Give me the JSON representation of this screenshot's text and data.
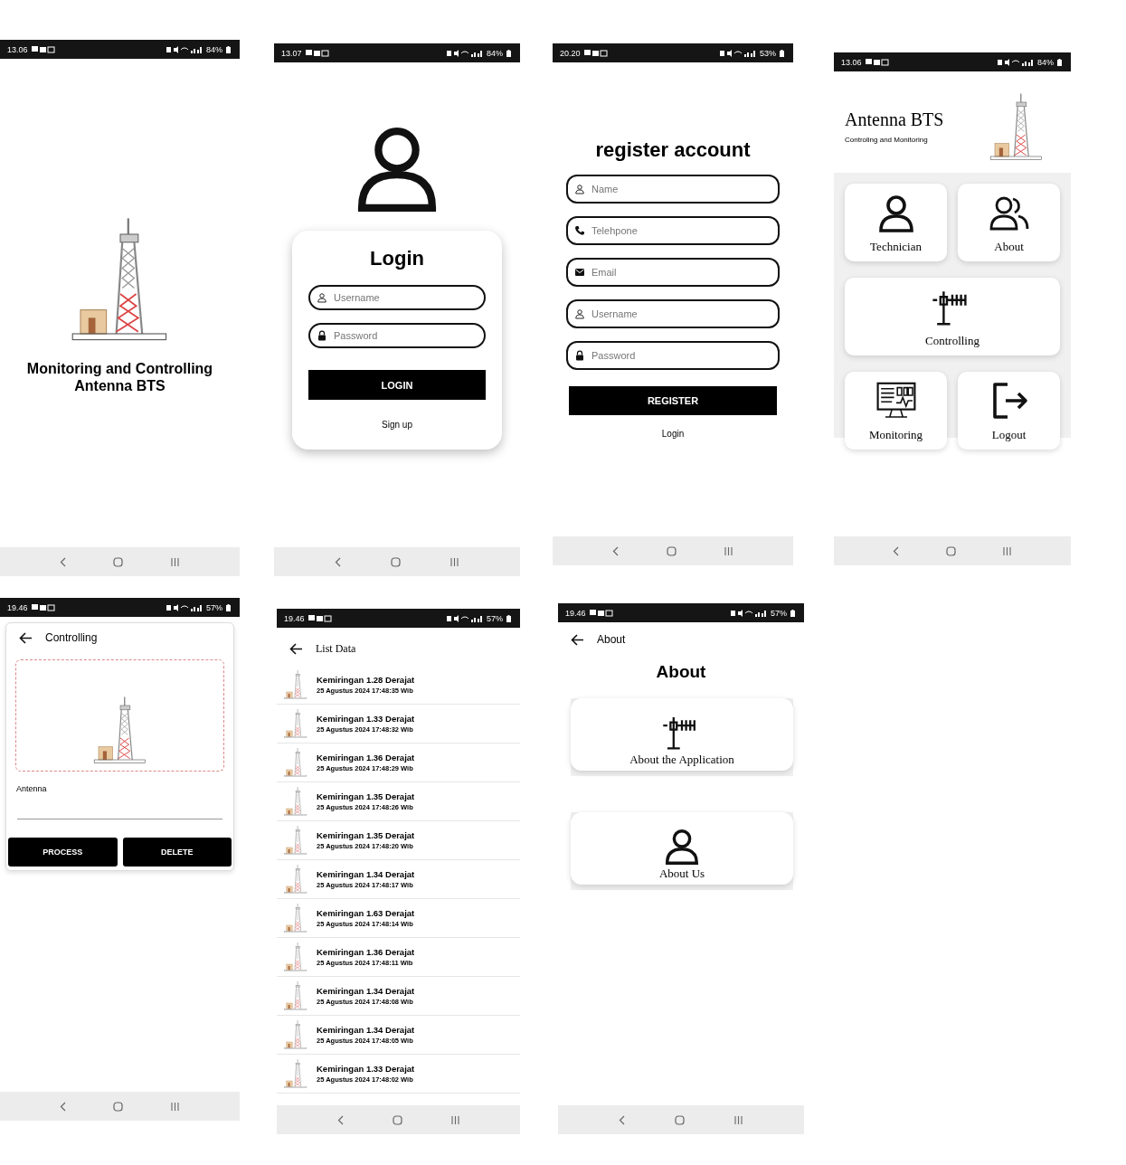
{
  "screens": [
    {
      "kind": "splash",
      "status": {
        "time": "13.06",
        "battery": "84%"
      },
      "title": "Monitoring and Controlling Antenna BTS"
    },
    {
      "kind": "login",
      "status": {
        "time": "13.07",
        "battery": "84%"
      },
      "heading": "Login",
      "fields": [
        {
          "placeholder": "Username"
        },
        {
          "placeholder": "Password"
        }
      ],
      "button": "LOGIN",
      "link": "Sign up"
    },
    {
      "kind": "register",
      "status": {
        "time": "20.20",
        "battery": "53%"
      },
      "heading": "register account",
      "fields": [
        {
          "placeholder": "Name"
        },
        {
          "placeholder": "Telehpone"
        },
        {
          "placeholder": "Email"
        },
        {
          "placeholder": "Username"
        },
        {
          "placeholder": "Password"
        }
      ],
      "button": "REGISTER",
      "link": "Login"
    },
    {
      "kind": "home",
      "status": {
        "time": "13.06",
        "battery": "84%"
      },
      "title": "Antenna BTS",
      "subtitle": "Controling and Monitoring",
      "tiles": [
        {
          "label": "Technician",
          "wide": false
        },
        {
          "label": "About",
          "wide": false
        },
        {
          "label": "Controlling",
          "wide": true
        },
        {
          "label": "Monitoring",
          "wide": false
        },
        {
          "label": "Logout",
          "wide": false
        }
      ]
    },
    {
      "kind": "controlling",
      "status": {
        "time": "19.46",
        "battery": "57%"
      },
      "title": "Controlling",
      "field_label": "Antenna",
      "buttons": [
        "PROCESS",
        "DELETE"
      ]
    },
    {
      "kind": "list",
      "status": {
        "time": "19.46",
        "battery": "57%"
      },
      "title": "List Data",
      "rows": [
        {
          "title": "Kemiringan 1.28 Derajat",
          "time": "25 Agustus 2024 17:48:35 Wib"
        },
        {
          "title": "Kemiringan 1.33 Derajat",
          "time": "25 Agustus 2024 17:48:32 Wib"
        },
        {
          "title": "Kemiringan 1.36 Derajat",
          "time": "25 Agustus 2024 17:48:29 Wib"
        },
        {
          "title": "Kemiringan 1.35 Derajat",
          "time": "25 Agustus 2024 17:48:26 Wib"
        },
        {
          "title": "Kemiringan 1.35 Derajat",
          "time": "25 Agustus 2024 17:48:20 Wib"
        },
        {
          "title": "Kemiringan 1.34 Derajat",
          "time": "25 Agustus 2024 17:48:17 Wib"
        },
        {
          "title": "Kemiringan 1.63 Derajat",
          "time": "25 Agustus 2024 17:48:14 Wib"
        },
        {
          "title": "Kemiringan 1.36 Derajat",
          "time": "25 Agustus 2024 17:48:11 Wib"
        },
        {
          "title": "Kemiringan 1.34 Derajat",
          "time": "25 Agustus 2024 17:48:08 Wib"
        },
        {
          "title": "Kemiringan 1.34 Derajat",
          "time": "25 Agustus 2024 17:48:05 Wib"
        },
        {
          "title": "Kemiringan 1.33 Derajat",
          "time": "25 Agustus 2024 17:48:02 Wib"
        }
      ]
    },
    {
      "kind": "about",
      "status": {
        "time": "19.46",
        "battery": "57%"
      },
      "title": "About",
      "heading": "About",
      "cards": [
        {
          "label": "About the Application"
        },
        {
          "label": "About Us"
        }
      ]
    }
  ]
}
